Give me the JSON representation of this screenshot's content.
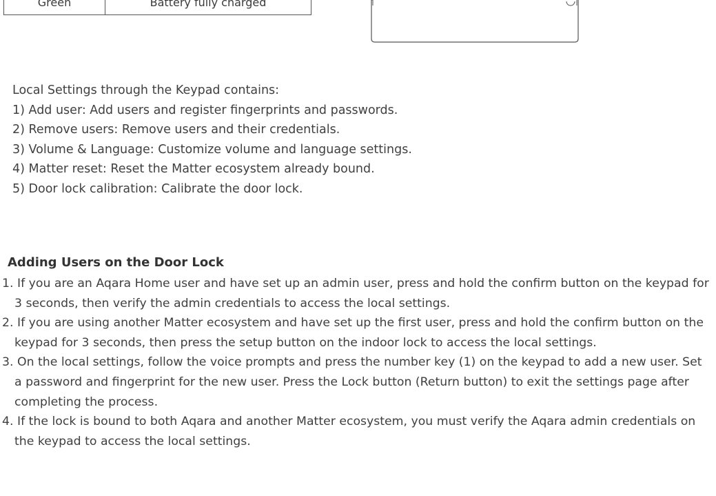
{
  "status_table": {
    "row": {
      "color": "Green",
      "meaning": "Battery fully charged"
    }
  },
  "local_settings": {
    "intro": "Local Settings through the Keypad contains:",
    "items": [
      "1) Add user: Add users and register fingerprints and passwords.",
      "2) Remove users: Remove users and their credentials.",
      "3) Volume & Language: Customize volume and language settings.",
      "4) Matter reset: Reset the Matter ecosystem already bound.",
      "5) Door lock calibration: Calibrate the door lock."
    ]
  },
  "adding_users": {
    "heading": "Adding Users on the Door Lock",
    "steps": [
      "1. If you are an Aqara Home user and have set up an admin user, press and hold the confirm button on the keypad for 3 seconds, then verify the admin credentials to access the local settings.",
      "2. If you are using another Matter ecosystem and have set up the first user, press and hold the confirm button on the keypad for 3 seconds, then press the setup button on the indoor lock to access the local settings.",
      "3. On the local settings, follow the voice prompts and press the number key (1) on the keypad to add a new user. Set a password and fingerprint for the new user. Press the Lock button (Return button) to exit the settings page after completing the process.",
      "4. If the lock is bound to both Aqara and another Matter ecosystem, you must verify the Aqara admin credentials on the keypad to access the local settings."
    ]
  }
}
